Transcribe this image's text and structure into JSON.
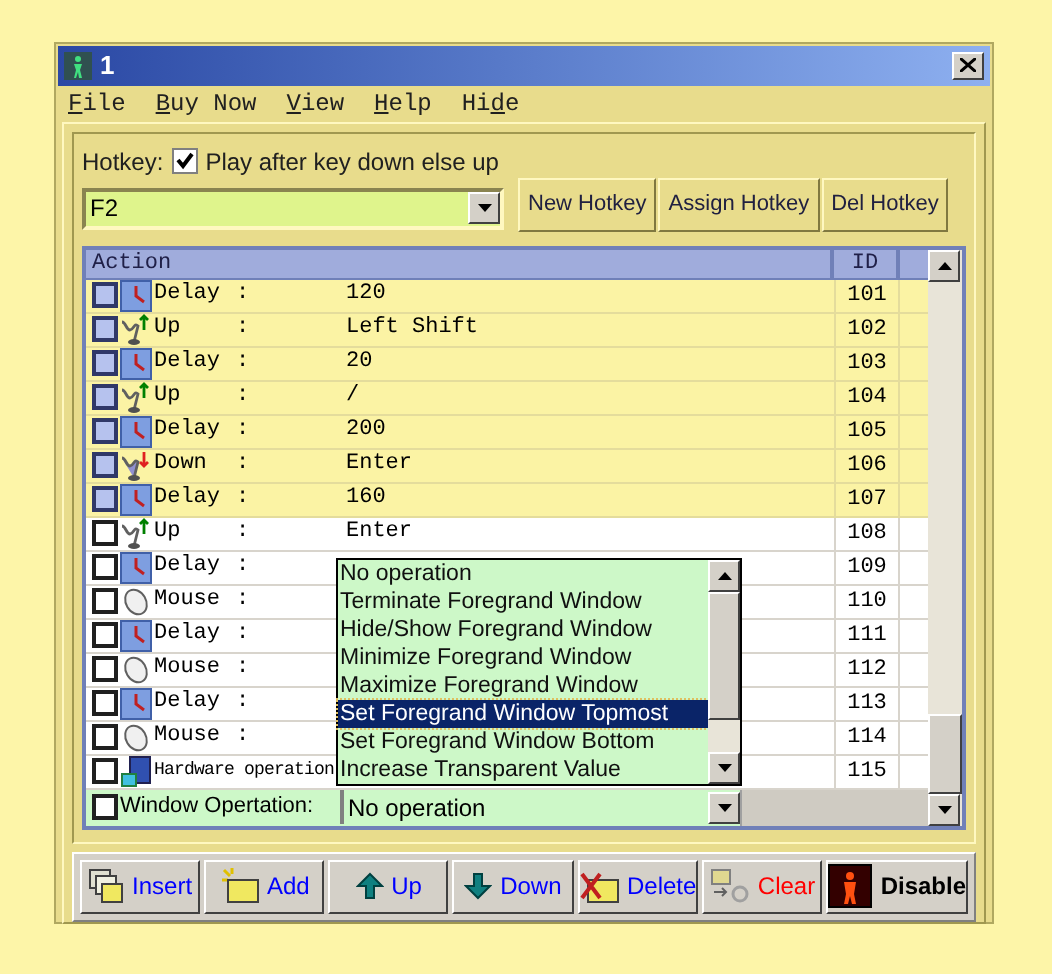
{
  "window": {
    "title": "1"
  },
  "menu": [
    {
      "mnemonic": "F",
      "rest": "ile"
    },
    {
      "mnemonic": "B",
      "rest": "uy Now"
    },
    {
      "mnemonic": "V",
      "rest": "iew"
    },
    {
      "mnemonic": "H",
      "rest": "elp"
    },
    {
      "lead": "Hi",
      "mnemonic": "d",
      "rest": "e"
    }
  ],
  "hotkey": {
    "label": "Hotkey:",
    "option": {
      "label": "Play after key down else up",
      "checked": true
    },
    "value": "F2"
  },
  "hotkey_buttons": [
    "New Hotkey",
    "Assign Hotkey",
    "Del Hotkey"
  ],
  "table": {
    "columns": [
      "Action",
      "ID"
    ],
    "rows": [
      {
        "kind": "delay",
        "action": "Delay",
        "colon": ":",
        "value": "120",
        "id": "101",
        "selected": true,
        "checked": false
      },
      {
        "kind": "up",
        "action": "Up",
        "colon": ":",
        "value": "Left Shift",
        "id": "102",
        "selected": true,
        "checked": false
      },
      {
        "kind": "delay",
        "action": "Delay",
        "colon": ":",
        "value": "20",
        "id": "103",
        "selected": true,
        "checked": false
      },
      {
        "kind": "up",
        "action": "Up",
        "colon": ":",
        "value": "/",
        "id": "104",
        "selected": true,
        "checked": false
      },
      {
        "kind": "delay",
        "action": "Delay",
        "colon": ":",
        "value": "200",
        "id": "105",
        "selected": true,
        "checked": false
      },
      {
        "kind": "down",
        "action": "Down",
        "colon": ":",
        "value": "Enter",
        "id": "106",
        "selected": true,
        "checked": false
      },
      {
        "kind": "delay",
        "action": "Delay",
        "colon": ":",
        "value": "160",
        "id": "107",
        "selected": true,
        "checked": false
      },
      {
        "kind": "up",
        "action": "Up",
        "colon": ":",
        "value": "Enter",
        "id": "108",
        "selected": false,
        "checked": false
      },
      {
        "kind": "delay",
        "action": "Delay",
        "colon": ":",
        "id": "109",
        "selected": false,
        "checked": false
      },
      {
        "kind": "mouse",
        "action": "Mouse",
        "colon": ":",
        "id": "110",
        "selected": false,
        "checked": false
      },
      {
        "kind": "delay",
        "action": "Delay",
        "colon": ":",
        "id": "111",
        "selected": false,
        "checked": false
      },
      {
        "kind": "mouse",
        "action": "Mouse",
        "colon": ":",
        "id": "112",
        "selected": false,
        "checked": false
      },
      {
        "kind": "delay",
        "action": "Delay",
        "colon": ":",
        "id": "113",
        "selected": false,
        "checked": false
      },
      {
        "kind": "mouse",
        "action": "Mouse",
        "colon": ":",
        "id": "114",
        "selected": false,
        "checked": false
      },
      {
        "kind": "hardware",
        "action": "Hardware operation",
        "id": "115",
        "selected": false,
        "checked": false
      }
    ]
  },
  "dropdown_list": {
    "items": [
      {
        "label": "No operation",
        "selected": false
      },
      {
        "label": "Terminate Foregrand Window",
        "selected": false
      },
      {
        "label": "Hide/Show Foregrand Window",
        "selected": false
      },
      {
        "label": "Minimize Foregrand Window",
        "selected": false
      },
      {
        "label": "Maximize Foregrand Window",
        "selected": false
      },
      {
        "label": "Set Foregrand Window Topmost",
        "selected": true
      },
      {
        "label": "Set Foregrand Window Bottom",
        "selected": false
      },
      {
        "label": "Increase Transparent Value",
        "selected": false
      }
    ]
  },
  "edit_row": {
    "label": "Window Opertation:",
    "checked": false,
    "value": "No operation"
  },
  "buttons": [
    {
      "kind": "insert",
      "label": "Insert",
      "color": "#0000ff"
    },
    {
      "kind": "add",
      "label": "Add",
      "color": "#0000ff"
    },
    {
      "kind": "up",
      "label": "Up",
      "color": "#0000ff"
    },
    {
      "kind": "down",
      "label": "Down",
      "color": "#0000ff"
    },
    {
      "kind": "delete",
      "label": "Delete",
      "color": "#0000ff"
    },
    {
      "kind": "clear",
      "label": "Clear",
      "color": "#ff0000"
    },
    {
      "kind": "disable",
      "label": "Disable",
      "color": "#000000"
    }
  ]
}
